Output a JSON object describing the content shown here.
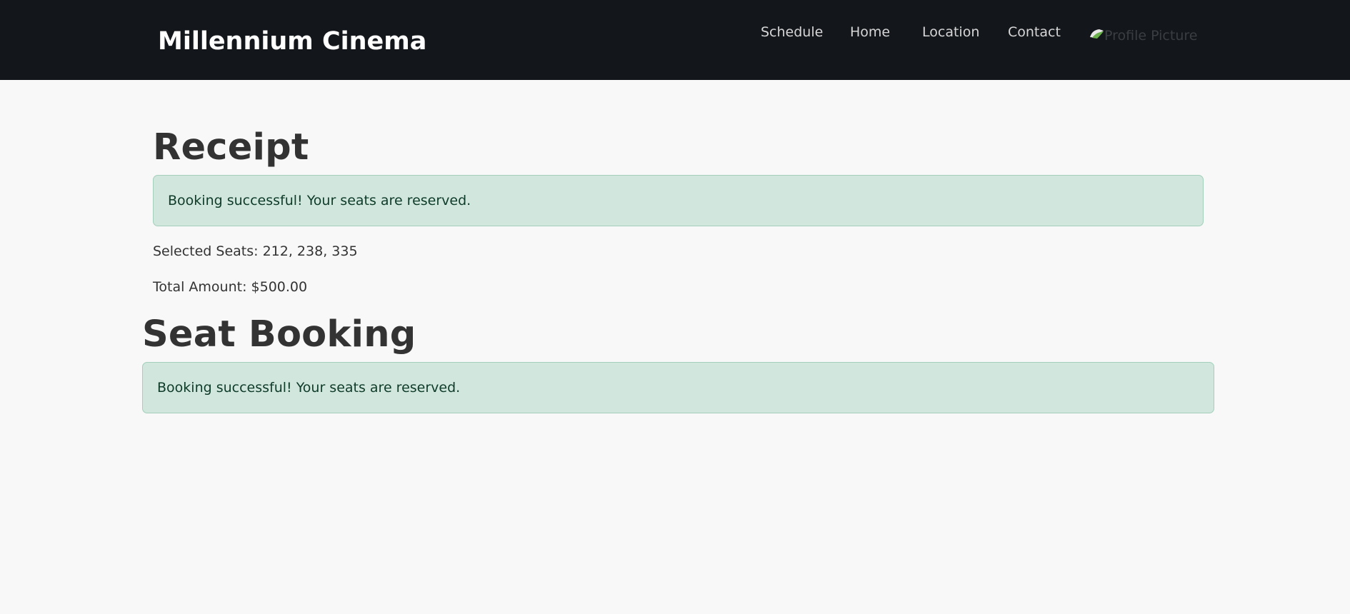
{
  "header": {
    "brand": "Millennium Cinema",
    "nav": {
      "schedule": "Schedule",
      "home": "Home",
      "location": "Location",
      "contact": "Contact"
    },
    "profile_alt": "Profile Picture",
    "profile_icon": "broken-image-icon"
  },
  "receipt": {
    "title": "Receipt",
    "alert": "Booking successful! Your seats are reserved.",
    "selected_seats": "Selected Seats: 212, 238, 335",
    "total_amount": "Total Amount: $500.00"
  },
  "seat_booking": {
    "title": "Seat Booking",
    "alert": "Booking successful! Your seats are reserved."
  },
  "colors": {
    "navbar_bg": "#13161b",
    "page_bg": "#f8f8f8",
    "alert_bg": "#d1e7dd",
    "alert_border": "#a3cfbb",
    "alert_text": "#0f3b29"
  }
}
